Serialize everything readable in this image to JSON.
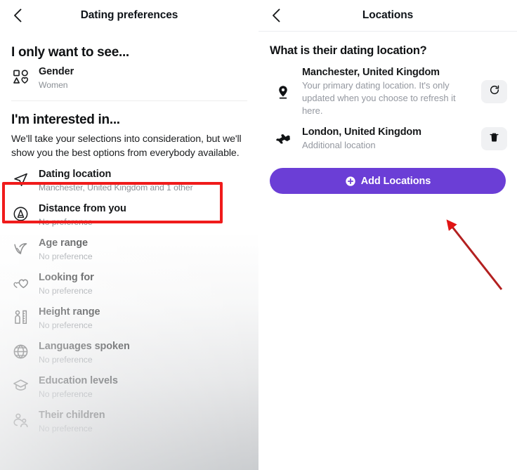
{
  "left_panel": {
    "header": {
      "title": "Dating preferences",
      "back_icon": "chevron-left-icon"
    },
    "section_only_see": {
      "title": "I only want to see...",
      "items": [
        {
          "icon": "gender-shapes-icon",
          "label": "Gender",
          "value": "Women"
        }
      ]
    },
    "section_interested": {
      "title": "I'm interested in...",
      "body": "We'll take your selections into consideration, but we'll show you the best options from everybody available.",
      "items": [
        {
          "icon": "paper-plane-icon",
          "label": "Dating location",
          "value": "Manchester, United Kingdom and 1 other",
          "highlighted": true
        },
        {
          "icon": "distance-marker-icon",
          "label": "Distance from you",
          "value": "No preference",
          "highlighted": false
        },
        {
          "icon": "age-range-icon",
          "label": "Age range",
          "value": "No preference",
          "highlighted": false
        },
        {
          "icon": "two-hearts-icon",
          "label": "Looking for",
          "value": "No preference",
          "highlighted": false
        },
        {
          "icon": "height-ruler-icon",
          "label": "Height range",
          "value": "No preference",
          "highlighted": false
        },
        {
          "icon": "globe-icon",
          "label": "Languages spoken",
          "value": "No preference",
          "highlighted": false
        },
        {
          "icon": "graduation-cap-icon",
          "label": "Education levels",
          "value": "No preference",
          "highlighted": false
        },
        {
          "icon": "people-children-icon",
          "label": "Their children",
          "value": "No preference",
          "highlighted": false
        }
      ]
    }
  },
  "right_panel": {
    "header": {
      "title": "Locations",
      "back_icon": "chevron-left-icon"
    },
    "question": "What is their dating location?",
    "locations": [
      {
        "icon": "map-pin-icon",
        "name": "Manchester, United Kingdom",
        "description": "Your primary dating location. It's only updated when you choose to refresh it here.",
        "action_icon": "refresh-icon"
      },
      {
        "icon": "airplane-icon",
        "name": "London, United Kingdom",
        "description": "Additional location",
        "action_icon": "trash-icon"
      }
    ],
    "add_button": {
      "label": "Add Locations",
      "icon": "plus-circle-icon"
    }
  },
  "annotations": {
    "highlight_color": "#f01b1b",
    "arrow_color": "#e11414",
    "accent_color": "#6b3ed6"
  }
}
